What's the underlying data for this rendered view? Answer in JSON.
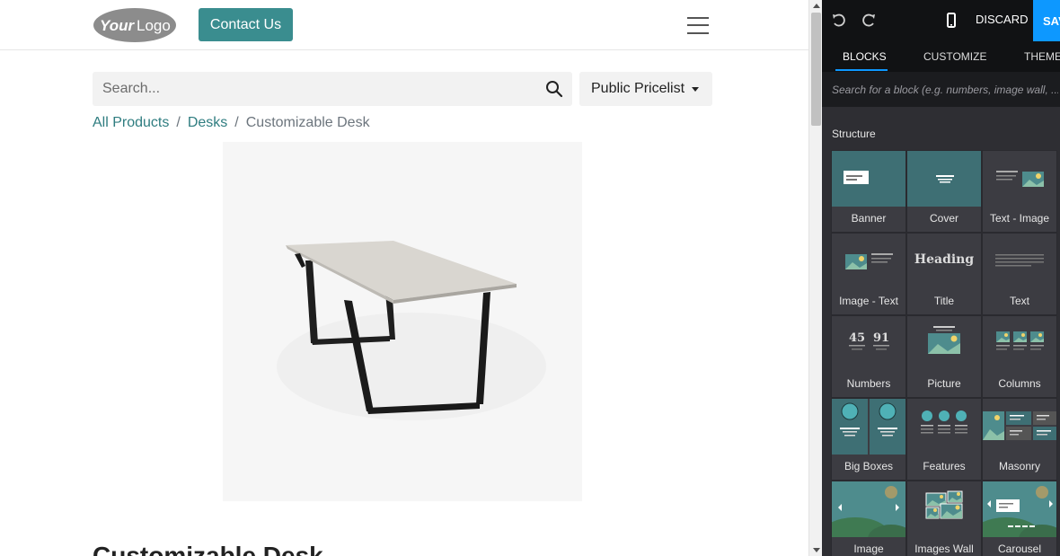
{
  "site": {
    "logo_alt": "YourLogo",
    "contact_label": "Contact Us",
    "search_placeholder": "Search...",
    "pricelist_label": "Public Pricelist",
    "breadcrumb": [
      "All Products",
      "Desks",
      "Customizable Desk"
    ],
    "product_title": "Customizable Desk"
  },
  "editor": {
    "discard_label": "DISCARD",
    "save_label": "SAVE",
    "tabs": [
      "BLOCKS",
      "CUSTOMIZE",
      "THEME"
    ],
    "block_search_placeholder": "Search for a block (e.g. numbers, image wall, ...)",
    "section_label": "Structure",
    "blocks": [
      {
        "label": "Banner",
        "icon": "banner-icon"
      },
      {
        "label": "Cover",
        "icon": "cover-icon"
      },
      {
        "label": "Text - Image",
        "icon": "text-image-icon"
      },
      {
        "label": "Image - Text",
        "icon": "image-text-icon"
      },
      {
        "label": "Title",
        "icon": "title-icon",
        "preview_text": "Heading"
      },
      {
        "label": "Text",
        "icon": "text-icon"
      },
      {
        "label": "Numbers",
        "icon": "numbers-icon",
        "preview_text": [
          "45",
          "91"
        ]
      },
      {
        "label": "Picture",
        "icon": "picture-icon"
      },
      {
        "label": "Columns",
        "icon": "columns-icon"
      },
      {
        "label": "Big Boxes",
        "icon": "big-boxes-icon"
      },
      {
        "label": "Features",
        "icon": "features-icon"
      },
      {
        "label": "Masonry",
        "icon": "masonry-icon"
      },
      {
        "label": "Image",
        "icon": "image-gallery-icon"
      },
      {
        "label": "Images Wall",
        "icon": "images-wall-icon"
      },
      {
        "label": "Carousel",
        "icon": "carousel-icon"
      }
    ]
  },
  "colors": {
    "primary": "#3a8d8f",
    "link": "#2f7d80",
    "editor_bg": "#2e2e33",
    "editor_topbar": "#111214",
    "accent_blue": "#0d98ff"
  }
}
